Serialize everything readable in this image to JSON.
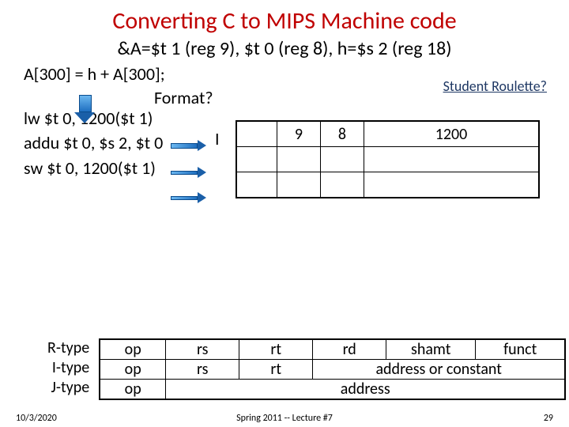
{
  "title": "Converting C to MIPS Machine code",
  "subtitle": "&A=$t 1 (reg 9), $t 0 (reg 8), h=$s 2 (reg 18)",
  "c_statement": "A[300] = h + A[300];",
  "format_label": "Format?",
  "instructions": {
    "lw": "lw $t 0, 1200($t 1)",
    "addu": "addu $t 0, $s 2, $t 0",
    "sw": "sw $t 0, 1200($t 1)"
  },
  "format_letters": {
    "i": " I",
    "blank2": " ",
    "blank3": " "
  },
  "bigtable": {
    "row1": {
      "op": "",
      "rs": "9",
      "rt": "8",
      "imm": "1200"
    },
    "row2": {
      "op": "",
      "rs": "",
      "rt": "",
      "imm": ""
    },
    "row3": {
      "op": "",
      "rs": "",
      "rt": "",
      "imm": ""
    }
  },
  "roulette": "Student Roulette?",
  "fmtlabels": {
    "r": "R-type",
    "i": "I-type",
    "j": "J-type"
  },
  "fmttable": {
    "r": {
      "op": "op",
      "rs": "rs",
      "rt": "rt",
      "rd": "rd",
      "sh": "shamt",
      "fn": "funct"
    },
    "i": {
      "op": "op",
      "rs": "rs",
      "rt": "rt",
      "imm": "address or constant"
    },
    "j": {
      "op": "op",
      "addr": "address"
    }
  },
  "footer": {
    "left": "10/3/2020",
    "center": "Spring 2011 -- Lecture #7",
    "right": "29"
  }
}
